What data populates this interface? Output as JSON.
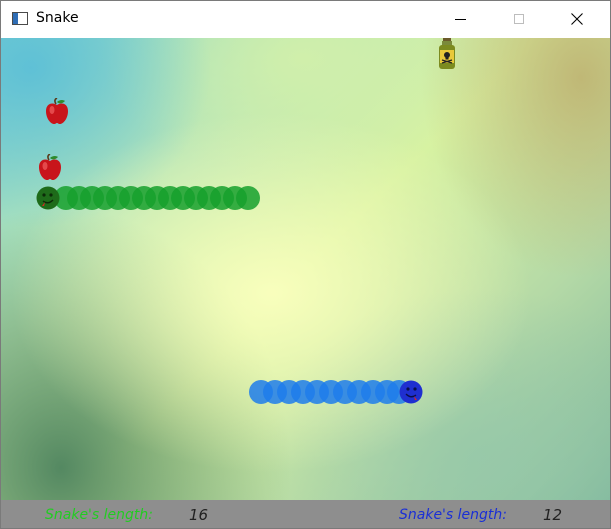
{
  "window": {
    "title": "Snake"
  },
  "game": {
    "snakes": [
      {
        "player": "green",
        "color": "#16a02d",
        "length": 16,
        "direction": "left"
      },
      {
        "player": "blue",
        "color": "#1e7deb",
        "length": 12,
        "direction": "right"
      }
    ],
    "items": [
      {
        "type": "apple",
        "icon": "apple-icon"
      },
      {
        "type": "apple",
        "icon": "apple-icon"
      },
      {
        "type": "poison",
        "icon": "poison-bottle-icon"
      }
    ]
  },
  "status": {
    "player1": {
      "label": "Snake's length:",
      "value": "16",
      "color": "#22cc22"
    },
    "player2": {
      "label": "Snake's length:",
      "value": "12",
      "color": "#1a2fd6"
    }
  }
}
